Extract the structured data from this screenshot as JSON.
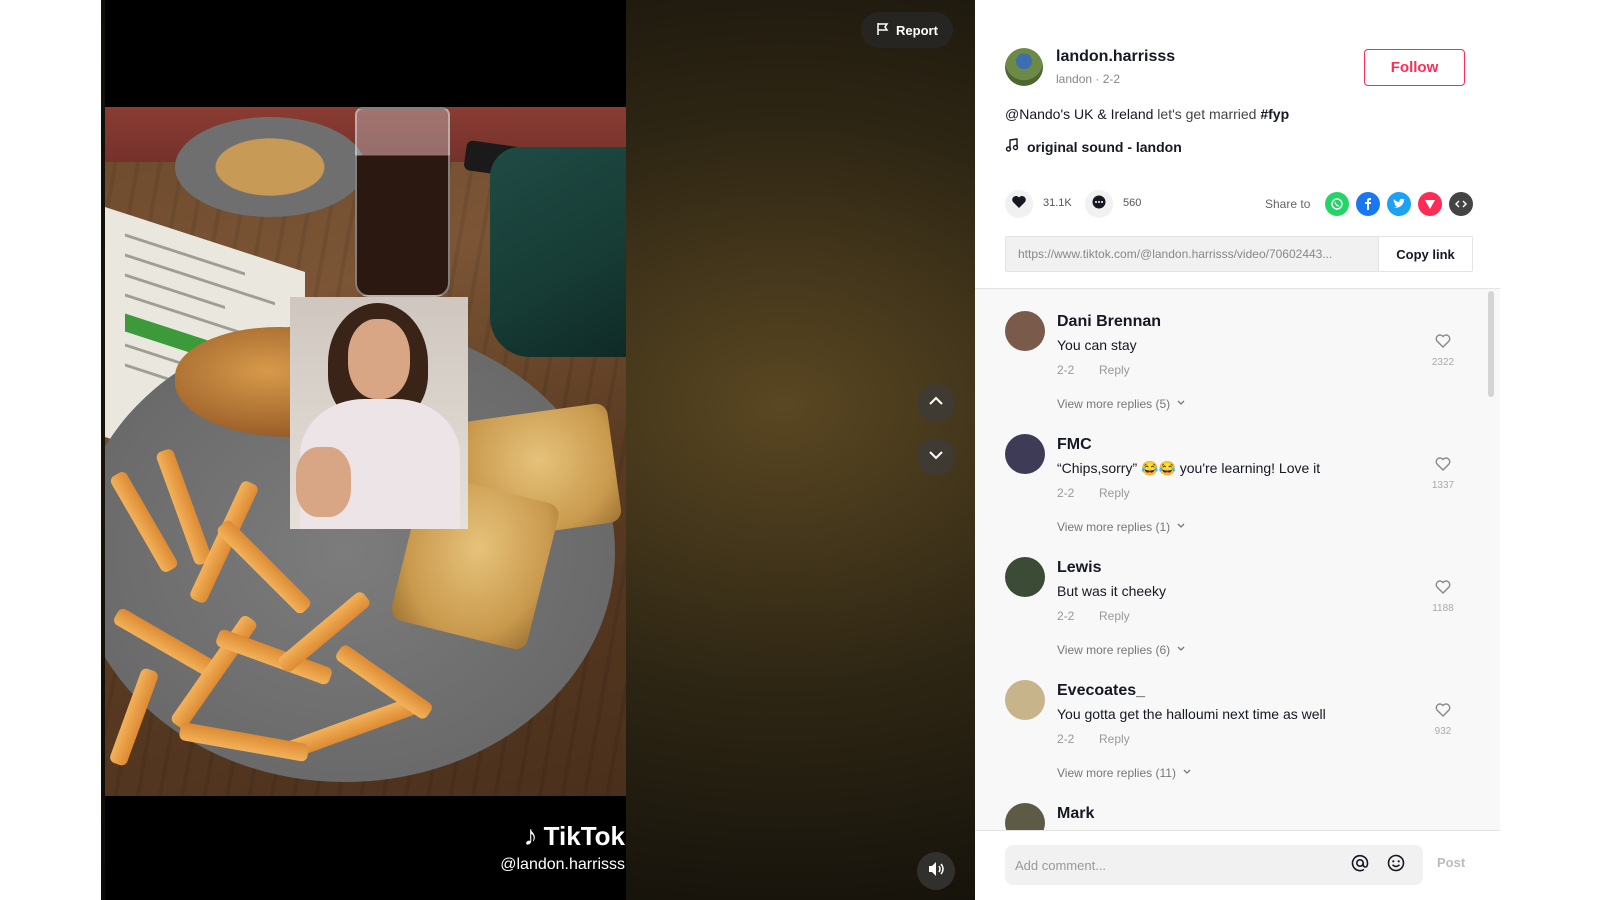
{
  "video": {
    "report_label": "Report",
    "watermark_brand": "TikTok",
    "watermark_handle": "@landon.harrisss"
  },
  "author": {
    "username": "landon.harrisss",
    "display_name": "landon",
    "date": "2-2",
    "follow_label": "Follow"
  },
  "caption": {
    "mention": "@Nando's UK & Ireland",
    "text": " let's get married ",
    "hashtag": "#fyp"
  },
  "sound": {
    "label": "original sound - landon",
    "icon": "music-note-icon"
  },
  "stats": {
    "likes": "31.1K",
    "comments": "560",
    "share_label": "Share to"
  },
  "share_targets": [
    {
      "name": "whatsapp",
      "color": "#25d366"
    },
    {
      "name": "facebook",
      "color": "#1877f2"
    },
    {
      "name": "twitter",
      "color": "#1da1f2"
    },
    {
      "name": "more-share",
      "color": "#fe2c55"
    },
    {
      "name": "embed",
      "color": "#444444"
    }
  ],
  "link": {
    "url": "https://www.tiktok.com/@landon.harrisss/video/70602443...",
    "copy_label": "Copy link"
  },
  "comments": [
    {
      "author": "Dani Brennan",
      "text": "You can stay",
      "date": "2-2",
      "reply": "Reply",
      "more": "View more replies (5)",
      "likes": "2322",
      "avatar_color": "#7a5a4a"
    },
    {
      "author": "FMC",
      "text": "“Chips,sorry” 😂😂 you're learning! Love it",
      "date": "2-2",
      "reply": "Reply",
      "more": "View more replies (1)",
      "likes": "1337",
      "avatar_color": "#3e3b57"
    },
    {
      "author": "Lewis",
      "text": "But was it cheeky",
      "date": "2-2",
      "reply": "Reply",
      "more": "View more replies (6)",
      "likes": "1188",
      "avatar_color": "#3c4b36"
    },
    {
      "author": "Evecoates_",
      "text": "You gotta get the halloumi next time as well",
      "date": "2-2",
      "reply": "Reply",
      "more": "View more replies (11)",
      "likes": "932",
      "avatar_color": "#c8b48a"
    },
    {
      "author": "Mark",
      "text": "",
      "date": "",
      "reply": "",
      "more": "",
      "likes": "",
      "avatar_color": "#5d5a46"
    }
  ],
  "comment_bar": {
    "placeholder": "Add comment...",
    "post_label": "Post"
  }
}
